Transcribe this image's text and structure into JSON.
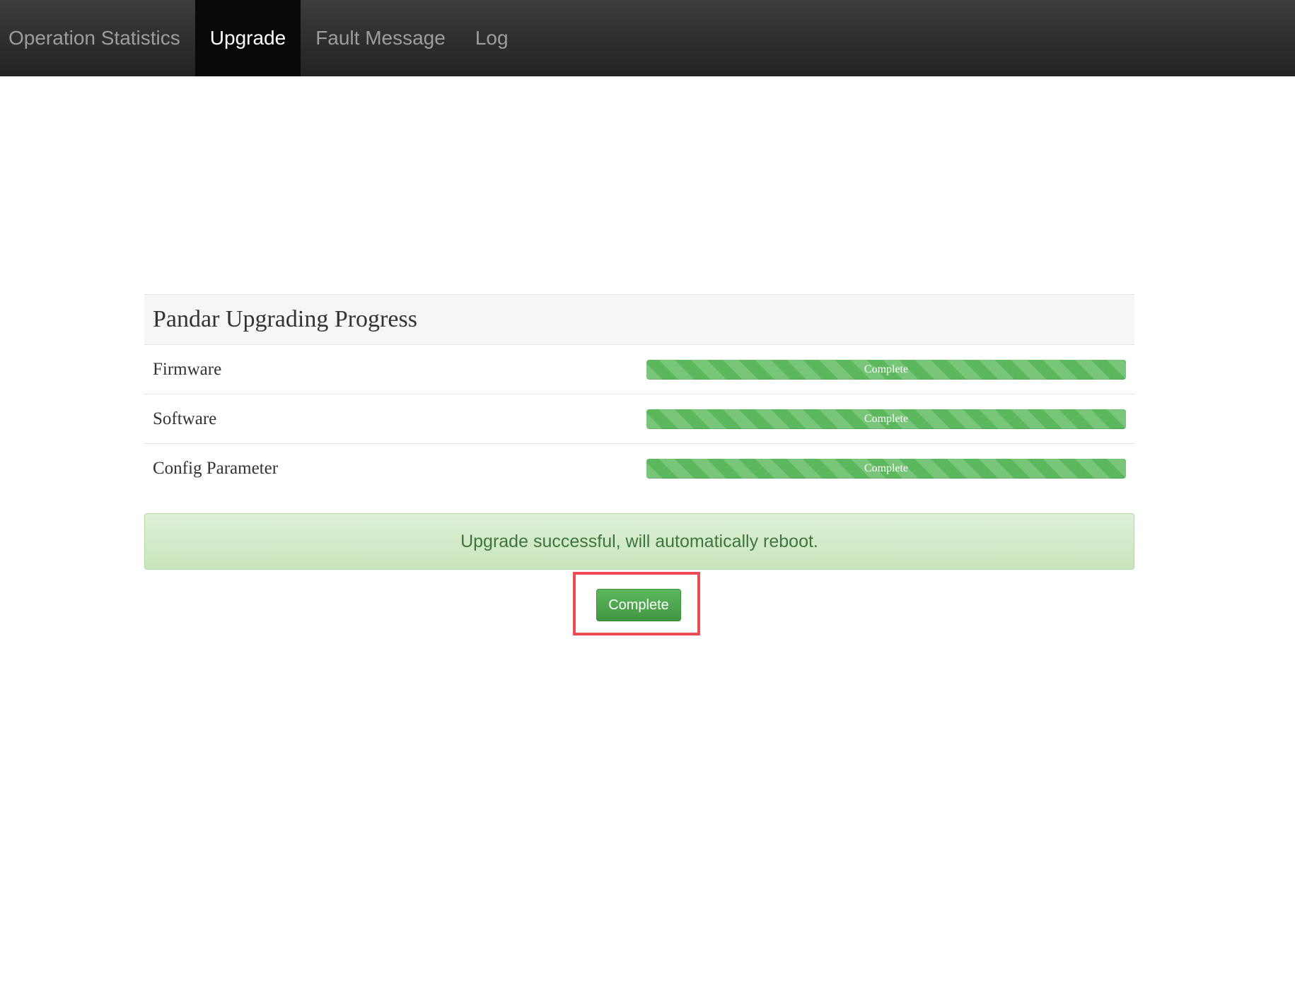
{
  "nav": {
    "items": [
      {
        "label": "Operation Statistics",
        "active": false
      },
      {
        "label": "Upgrade",
        "active": true
      },
      {
        "label": "Fault Message",
        "active": false
      },
      {
        "label": "Log",
        "active": false
      }
    ]
  },
  "panel": {
    "title": "Pandar Upgrading Progress",
    "rows": [
      {
        "label": "Firmware",
        "progress_label": "Complete",
        "progress_percent": 100
      },
      {
        "label": "Software",
        "progress_label": "Complete",
        "progress_percent": 100
      },
      {
        "label": "Config Parameter",
        "progress_label": "Complete",
        "progress_percent": 100
      }
    ]
  },
  "alert": {
    "message": "Upgrade successful, will automatically reboot."
  },
  "complete_button": {
    "label": "Complete"
  },
  "colors": {
    "success_green": "#5cb85c",
    "highlight_red": "#ee4b55",
    "navbar_dark": "#222222"
  }
}
